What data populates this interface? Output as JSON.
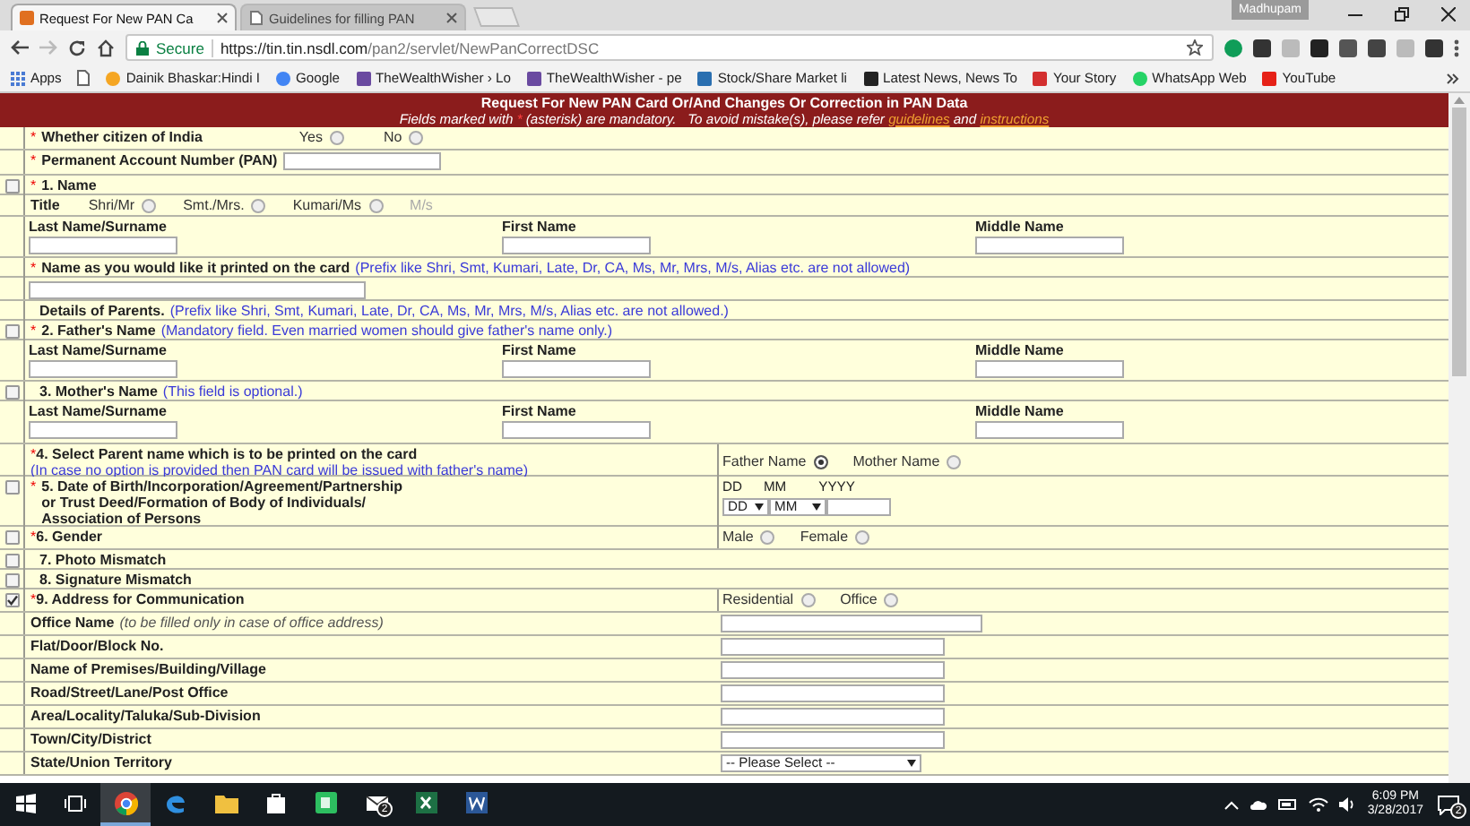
{
  "browser": {
    "user": "Madhupam",
    "tabs": [
      {
        "title": "Request For New PAN Ca",
        "selected": true
      },
      {
        "title": "Guidelines for filling PAN",
        "selected": false
      }
    ],
    "address": {
      "security": "Secure",
      "host": "https://tin.tin.nsdl.com",
      "path": "/pan2/servlet/NewPanCorrectDSC"
    },
    "bookmarks": [
      {
        "kind": "apps",
        "label": "Apps"
      },
      {
        "kind": "page"
      },
      {
        "kind": "dot",
        "label": "Dainik Bhaskar:Hindi I",
        "color": "#f5a623"
      },
      {
        "kind": "dot",
        "label": "Google",
        "color": "#4285f4"
      },
      {
        "kind": "square",
        "label": "TheWealthWisher › Lo",
        "color": "#6a4aa0"
      },
      {
        "kind": "square",
        "label": "TheWealthWisher - pe",
        "color": "#6a4aa0"
      },
      {
        "kind": "square",
        "label": "Stock/Share Market li",
        "color": "#2a6fb0"
      },
      {
        "kind": "square",
        "label": "Latest News, News To",
        "color": "#222222"
      },
      {
        "kind": "square",
        "label": "Your Story",
        "color": "#d32f2f"
      },
      {
        "kind": "dot",
        "label": "WhatsApp Web",
        "color": "#25d366"
      },
      {
        "kind": "square",
        "label": "YouTube",
        "color": "#e62117"
      }
    ]
  },
  "form": {
    "title": "Request For New PAN Card Or/And Changes Or Correction in PAN Data",
    "note": {
      "before": "Fields marked with",
      "mark": "*",
      "middle": "(asterisk) are mandatory.   To avoid mistake(s), please refer",
      "link_1": "guidelines",
      "joiner": "and",
      "link_2": "instructions"
    },
    "rows": [
      {
        "kind": "inline_radio",
        "mark": "*",
        "label": "Whether citizen of India",
        "options": [
          {
            "label": "Yes",
            "selected": false
          },
          {
            "label": "No",
            "selected": false
          }
        ]
      },
      {
        "kind": "inline_input",
        "mark": "*",
        "label": "Permanent Account Number (PAN)"
      },
      {
        "kind": "heading",
        "checked": false,
        "mark": "*",
        "label": "1. Name"
      },
      {
        "kind": "title",
        "label": "Title",
        "options": [
          {
            "label": "Shri/Mr",
            "selected": false,
            "disabled": false
          },
          {
            "label": "Smt./Mrs.",
            "selected": false,
            "disabled": false
          },
          {
            "label": "Kumari/Ms",
            "selected": false,
            "disabled": false
          },
          {
            "label": "M/s",
            "disabled": true
          }
        ]
      },
      {
        "kind": "names",
        "fields": [
          "Last Name/Surname",
          "First Name",
          "Middle Name"
        ]
      },
      {
        "kind": "heading",
        "mark": "*",
        "label": "Name as you would like it printed on the card",
        "hint": "(Prefix like Shri, Smt, Kumari, Late, Dr, CA, Ms, Mr, Mrs, M/s, Alias etc. are not allowed)"
      },
      {
        "kind": "wide_input"
      },
      {
        "kind": "heading",
        "label": "Details of Parents.",
        "hint": "(Prefix like Shri, Smt, Kumari, Late, Dr, CA, Ms, Mr, Mrs, M/s, Alias etc. are not allowed.)"
      },
      {
        "kind": "heading",
        "checked": false,
        "mark": "*",
        "label": "2. Father's Name",
        "hint": "(Mandatory field. Even married women should give father's name only.)"
      },
      {
        "kind": "names",
        "fields": [
          "Last Name/Surname",
          "First Name",
          "Middle Name"
        ]
      },
      {
        "kind": "heading",
        "checked": false,
        "label": "3. Mother's Name",
        "hint": "(This field is optional.)"
      },
      {
        "kind": "names",
        "fields": [
          "Last Name/Surname",
          "First Name",
          "Middle Name"
        ]
      },
      {
        "kind": "choice",
        "mark": "*",
        "label": "4. Select Parent name which is to be printed on the card",
        "hint": "(In case no option is provided then PAN card will be issued with father's name)",
        "options": [
          {
            "label": "Father Name",
            "selected": true
          },
          {
            "label": "Mother Name",
            "selected": false
          }
        ]
      },
      {
        "kind": "dob",
        "checked": false,
        "mark": "*",
        "label": "5. Date of Birth/Incorporation/Agreement/Partnership\nor Trust Deed/Formation of Body of Individuals/\nAssociation of Persons",
        "date_labels": [
          "DD",
          "MM",
          "YYYY"
        ],
        "selects": [
          "DD",
          "MM"
        ]
      },
      {
        "kind": "choice",
        "checked": false,
        "mark": "*",
        "label": "6. Gender",
        "options": [
          {
            "label": "Male",
            "selected": false
          },
          {
            "label": "Female",
            "selected": false
          }
        ]
      },
      {
        "kind": "heading",
        "checked": false,
        "label": "7. Photo Mismatch"
      },
      {
        "kind": "heading",
        "checked": false,
        "label": "8. Signature Mismatch"
      },
      {
        "kind": "choice",
        "checked": true,
        "mark": "*",
        "label": "9. Address for Communication",
        "options": [
          {
            "label": "Residential",
            "selected": false
          },
          {
            "label": "Office",
            "selected": false
          }
        ]
      },
      {
        "kind": "address",
        "label": "Office Name",
        "note": "(to be filled only in case of office address)",
        "control": {
          "kind": "wide"
        }
      },
      {
        "kind": "address",
        "label": "Flat/Door/Block No.",
        "control": {
          "kind": "text"
        }
      },
      {
        "kind": "address",
        "label": "Name of Premises/Building/Village",
        "control": {
          "kind": "text"
        }
      },
      {
        "kind": "address",
        "label": "Road/Street/Lane/Post Office",
        "control": {
          "kind": "text"
        }
      },
      {
        "kind": "address",
        "label": "Area/Locality/Taluka/Sub-Division",
        "control": {
          "kind": "text"
        }
      },
      {
        "kind": "address",
        "label": "Town/City/District",
        "control": {
          "kind": "text"
        }
      },
      {
        "kind": "address",
        "label": "State/Union Territory",
        "control": {
          "kind": "select",
          "value": "-- Please Select --"
        }
      }
    ]
  },
  "taskbar": {
    "apps": [
      {
        "kind": "start",
        "selected": false
      },
      {
        "kind": "taskview",
        "selected": false
      },
      {
        "kind": "chrome",
        "selected": true
      },
      {
        "kind": "edge",
        "selected": false
      },
      {
        "kind": "folder",
        "selected": false
      },
      {
        "kind": "store",
        "selected": false
      },
      {
        "kind": "notes",
        "selected": false
      },
      {
        "kind": "mail",
        "selected": false,
        "badge": "2"
      },
      {
        "kind": "excel",
        "selected": false
      },
      {
        "kind": "word",
        "selected": false
      }
    ],
    "time": "6:09 PM",
    "date": "3/28/2017",
    "notifications": "2"
  }
}
